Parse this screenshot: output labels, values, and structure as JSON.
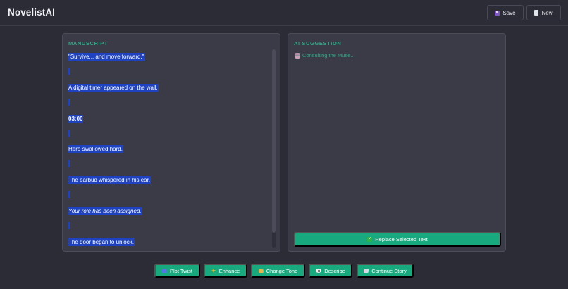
{
  "app": {
    "title": "NovelistAI"
  },
  "header": {
    "save_label": "Save",
    "new_label": "New"
  },
  "manuscript": {
    "heading": "MANUSCRIPT",
    "lines": [
      {
        "text": "\"Survive... and move forward.\"",
        "style": "normal"
      },
      {
        "text": "A digital timer appeared on the wall.",
        "style": "normal"
      },
      {
        "text": "03:00",
        "style": "bold"
      },
      {
        "text": "Hero swallowed hard.",
        "style": "normal"
      },
      {
        "text": "The earbud whispered in his ear.",
        "style": "normal"
      },
      {
        "text": "Your role has been assigned.",
        "style": "italic"
      },
      {
        "text": "The door began to unlock.",
        "style": "normal"
      }
    ]
  },
  "suggestion": {
    "heading": "AI SUGGESTION",
    "status": "Consulting the Muse...",
    "replace_label": "Replace Selected Text"
  },
  "actions": [
    {
      "label": "Plot Twist",
      "icon": "plot-twist-icon"
    },
    {
      "label": "Enhance",
      "icon": "sparkles-icon"
    },
    {
      "label": "Change Tone",
      "icon": "theater-icon"
    },
    {
      "label": "Describe",
      "icon": "eye-icon"
    },
    {
      "label": "Continue Story",
      "icon": "rocket-icon"
    }
  ],
  "colors": {
    "background": "#2b2c36",
    "panel": "#3a3b46",
    "accent": "#19a97e",
    "accent_text": "#2ea987",
    "selection": "#1f43c0"
  }
}
